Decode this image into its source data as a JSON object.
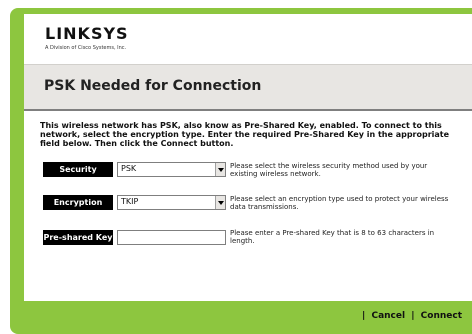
{
  "brand": {
    "logo": "LINKSYS",
    "subtitle": "A Division of Cisco Systems, Inc."
  },
  "page": {
    "title": "PSK Needed for Connection",
    "instructions": "This wireless network has PSK, also know as Pre-Shared Key, enabled. To connect to this network, select the encryption type. Enter the required Pre-Shared Key in the appropriate field below. Then click the Connect button."
  },
  "form": {
    "security": {
      "label": "Security",
      "value": "PSK",
      "description": "Please select the wireless security method used by your existing wireless network."
    },
    "encryption": {
      "label": "Encryption",
      "value": "TKIP",
      "description": "Please select an encryption type used to protect your wireless data transmissions."
    },
    "psk": {
      "label": "Pre-shared Key",
      "value": "",
      "description": "Please enter a Pre-shared Key that is 8 to 63 characters in length."
    }
  },
  "footer": {
    "separator": "|",
    "cancel": "Cancel",
    "connect": "Connect"
  },
  "colors": {
    "accent_green": "#8dc63f",
    "label_bg": "#000000"
  }
}
